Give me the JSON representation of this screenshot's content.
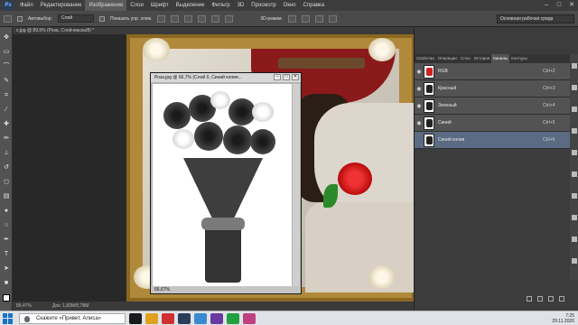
{
  "app": {
    "logo": "Ps"
  },
  "menu": [
    "Файл",
    "Редактирование",
    "Изображение",
    "Слои",
    "Шрифт",
    "Выделение",
    "Фильтр",
    "3D",
    "Просмотр",
    "Окно",
    "Справка"
  ],
  "options": {
    "autoselect_label": "Автовыбор:",
    "autoselect_value": "Слой",
    "transform_label": "Показать упр. элем.",
    "mode_label": "3D-режим:"
  },
  "workspace": "Основная рабочая среда",
  "doc_tab": "х.jpg @ 89,5% (Роза, Слой-маска/8) *",
  "subwindow": {
    "title": "Роза.jpg @ 66,7% (Слой 0, Синий копия...",
    "zoom": "66,67%"
  },
  "status": {
    "zoom": "89,47%",
    "doc": "Док: 1,83М/5,78М"
  },
  "panel_tabs": [
    "Свойства",
    "Операции",
    "Слои",
    "История",
    "Каналы",
    "Контуры"
  ],
  "active_tab": "Каналы",
  "channels": [
    {
      "name": "RGB",
      "shortcut": "Ctrl+2",
      "color": "#cc2222"
    },
    {
      "name": "Красный",
      "shortcut": "Ctrl+3",
      "color": "#222222"
    },
    {
      "name": "Зеленый",
      "shortcut": "Ctrl+4",
      "color": "#222222"
    },
    {
      "name": "Синий",
      "shortcut": "Ctrl+5",
      "color": "#222222"
    },
    {
      "name": "Синий копия",
      "shortcut": "Ctrl+6",
      "color": "#222222",
      "selected": true
    }
  ],
  "taskbar": {
    "search": "Скажите «Привет, Алиса»",
    "time": "7:25",
    "date": "29.11.2020"
  },
  "colors": {
    "accent": "#5b6b84",
    "frame": "#b08a3a"
  }
}
